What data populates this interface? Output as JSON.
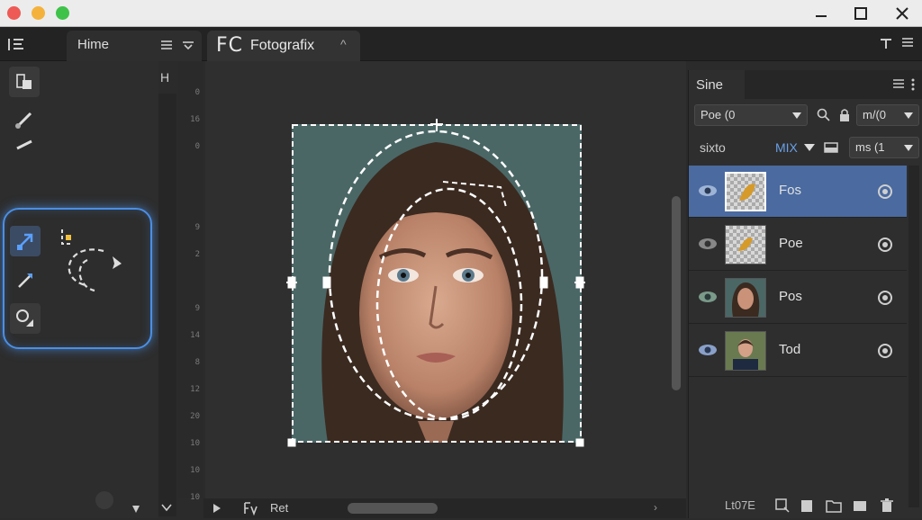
{
  "titlebar": {
    "minimize_icon": "minimize-icon",
    "maximize_icon": "maximize-icon",
    "close_icon": "close-icon"
  },
  "tabs": {
    "left_tab_label": "Hime",
    "app_logo": "FC",
    "app_name": "Fotografix",
    "chevron_up": "^"
  },
  "left_panel": {
    "header_label": "H"
  },
  "canvas": {
    "ruler_ticks": [
      "0",
      "16",
      "0",
      "",
      "",
      "9",
      "2",
      "",
      "9",
      "14",
      "8",
      "12",
      "20",
      "10",
      "10",
      "10"
    ],
    "bottom_label": "Ret"
  },
  "right_panel": {
    "tab_label": "Sine",
    "row1": {
      "select_value": "Poe (0",
      "lock_value": "m/(0"
    },
    "row2": {
      "label": "sixto",
      "blend_value": "MIX",
      "opacity_value": "ms (1"
    },
    "layers": [
      {
        "name": "Fos",
        "selected": true,
        "thumb": "checker-leaf"
      },
      {
        "name": "Poe",
        "selected": false,
        "thumb": "checker-leaf"
      },
      {
        "name": "Pos",
        "selected": false,
        "thumb": "portrait"
      },
      {
        "name": "Tod",
        "selected": false,
        "thumb": "child"
      }
    ],
    "footer_label": "Lt07E"
  },
  "colors": {
    "accent": "#4a8fe6",
    "selected_layer": "#4a6aa0",
    "background": "#2b2b2b"
  }
}
